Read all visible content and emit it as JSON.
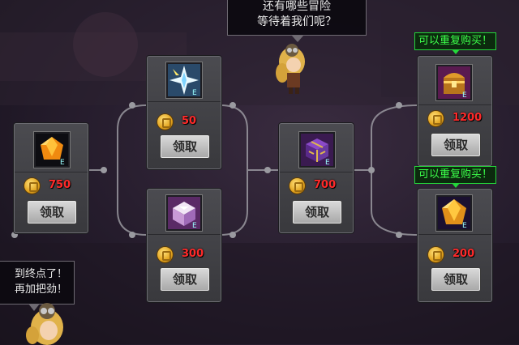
{
  "dialogs": {
    "top": [
      "还有哪些冒险",
      "等待着我们呢？"
    ],
    "left": [
      "到终点了！",
      "再加把劲！"
    ]
  },
  "badge_text": "可以重复购买！",
  "claim_label": "领取",
  "items": [
    {
      "id": "orange-gem",
      "price": "750",
      "icon": "orange-gem-icon"
    },
    {
      "id": "crystal-burst",
      "price": "50",
      "icon": "crystal-burst-icon"
    },
    {
      "id": "pink-box",
      "price": "300",
      "icon": "pink-box-icon"
    },
    {
      "id": "purple-box",
      "price": "700",
      "icon": "purple-box-icon"
    },
    {
      "id": "treasure-chest",
      "price": "1200",
      "icon": "treasure-chest-icon",
      "repeatable": true
    },
    {
      "id": "golden-gem",
      "price": "200",
      "icon": "golden-gem-icon",
      "repeatable": true
    }
  ],
  "colors": {
    "price": "#ff2a2a",
    "badge": "#3cff4a",
    "coin": "#e2a21c"
  }
}
